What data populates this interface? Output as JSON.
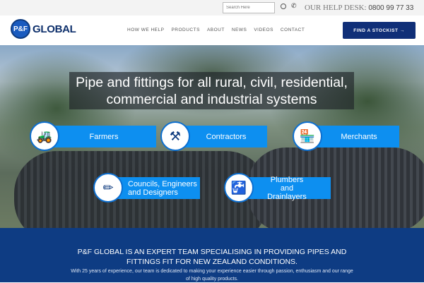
{
  "topbar": {
    "search_placeholder": "Search Here",
    "help_label": "OUR HELP DESK:",
    "help_number": "0800 99 77 33"
  },
  "logo": {
    "mark": "P&F",
    "text": "GLOBAL"
  },
  "nav": {
    "items": [
      "HOW WE HELP",
      "PRODUCTS",
      "ABOUT",
      "NEWS",
      "VIDEOS",
      "CONTACT"
    ],
    "cta": "FIND A STOCKIST →"
  },
  "hero": {
    "headline": "Pipe and fittings for all rural, civil, residential, commercial and industrial systems",
    "buttons": [
      {
        "label": "Farmers",
        "icon": "tractor-icon"
      },
      {
        "label": "Contractors",
        "icon": "shovel-icon"
      },
      {
        "label": "Merchants",
        "icon": "shop-icon"
      },
      {
        "label": "Councils, Engineers and Designers",
        "icon": "ruler-pencil-icon"
      },
      {
        "label": "Plumbers and Drainlayers",
        "icon": "tap-icon"
      }
    ]
  },
  "about": {
    "title": "P&F GLOBAL IS AN EXPERT TEAM SPECIALISING IN PROVIDING PIPES AND FITTINGS FIT FOR NEW ZEALAND CONDITIONS.",
    "text": "With 25 years of experience, our team is dedicated to making your experience easier through passion, enthusiasm and our range of high quality products."
  }
}
